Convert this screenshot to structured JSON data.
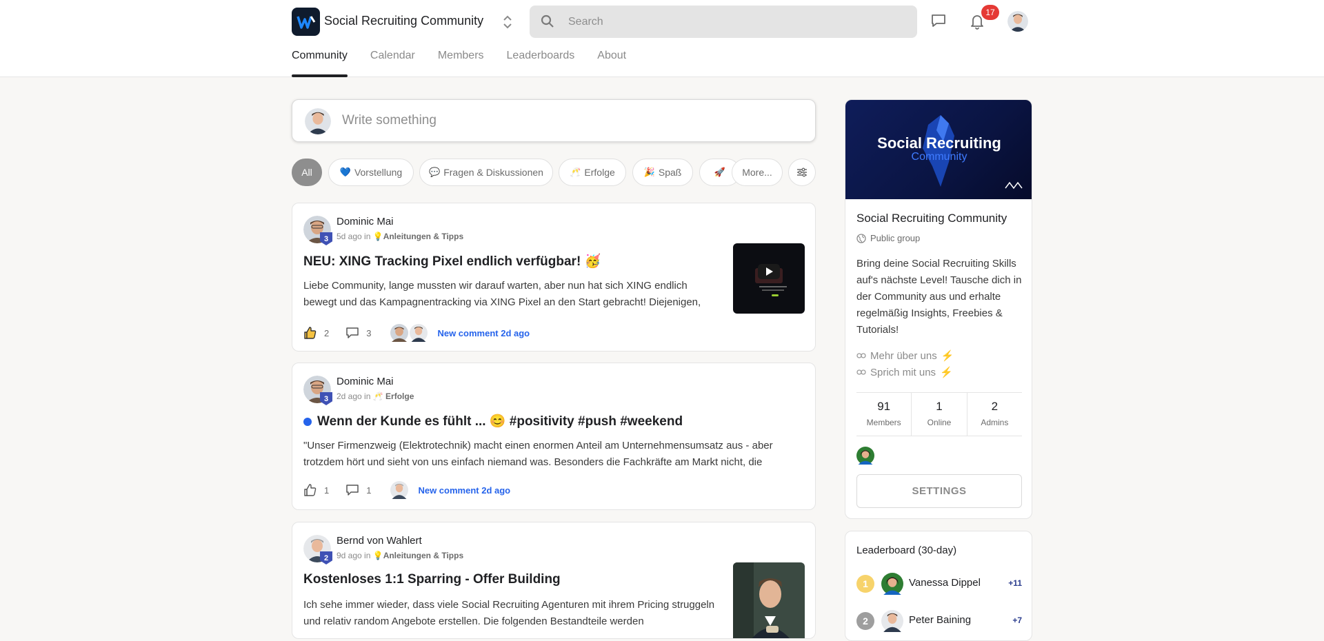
{
  "header": {
    "brand": "Social Recruiting Community",
    "search_placeholder": "Search",
    "notifications_count": "17"
  },
  "nav": {
    "tabs": [
      {
        "label": "Community",
        "active": true
      },
      {
        "label": "Calendar",
        "active": false
      },
      {
        "label": "Members",
        "active": false
      },
      {
        "label": "Leaderboards",
        "active": false
      },
      {
        "label": "About",
        "active": false
      }
    ]
  },
  "composer": {
    "placeholder": "Write something"
  },
  "filters": {
    "all": "All",
    "chips": [
      {
        "emoji": "💙",
        "label": "Vorstellung"
      },
      {
        "emoji": "💬",
        "label": "Fragen & Diskussionen"
      },
      {
        "emoji": "🥂",
        "label": "Erfolge"
      },
      {
        "emoji": "🎉",
        "label": "Spaß"
      },
      {
        "emoji": "🚀",
        "label": ""
      }
    ],
    "more": "More..."
  },
  "posts": [
    {
      "author": "Dominic Mai",
      "level": "3",
      "time": "5d ago in",
      "category_emoji": "💡",
      "category": "Anleitungen & Tipps",
      "title": "NEU: XING Tracking Pixel endlich verfügbar! 🥳",
      "body": "Liebe Community, lange mussten wir darauf warten, aber nun hat sich XING endlich bewegt und das Kampagnentracking via XING Pixel an den Start gebracht! Diejenigen,",
      "likes": "2",
      "comments": "3",
      "new_comment": "New comment 2d ago",
      "unread": false
    },
    {
      "author": "Dominic Mai",
      "level": "3",
      "time": "2d ago in",
      "category_emoji": "🥂",
      "category": "Erfolge",
      "title": "Wenn der Kunde es fühlt ... 😊 #positivity #push #weekend",
      "body": "\"Unser Firmenzweig (Elektrotechnik) macht einen enormen Anteil am Unternehmensumsatz aus - aber trotzdem hört und sieht von uns einfach niemand was. Besonders die Fachkräfte am Markt nicht, die",
      "likes": "1",
      "comments": "1",
      "new_comment": "New comment 2d ago",
      "unread": true
    },
    {
      "author": "Bernd von Wahlert",
      "level": "2",
      "time": "9d ago in",
      "category_emoji": "💡",
      "category": "Anleitungen & Tipps",
      "title": "Kostenloses 1:1 Sparring - Offer Building",
      "body": "Ich sehe immer wieder, dass viele Social Recruiting Agenturen mit ihrem Pricing struggeln und relativ random Angebote erstellen. Die folgenden Bestandteile werden",
      "unread": false
    }
  ],
  "group": {
    "banner_line1": "Social Recruiting",
    "banner_line2": "Community",
    "name": "Social Recruiting Community",
    "type": "Public group",
    "description": "Bring deine Social Recruiting Skills auf's nächste Level! Tausche dich in der Community aus und erhalte regelmäßig Insights, Freebies & Tutorials!",
    "links": [
      {
        "label": "Mehr über uns",
        "emoji": "⚡"
      },
      {
        "label": "Sprich mit uns",
        "emoji": "⚡"
      }
    ],
    "stats": [
      {
        "value": "91",
        "label": "Members"
      },
      {
        "value": "1",
        "label": "Online"
      },
      {
        "value": "2",
        "label": "Admins"
      }
    ],
    "settings_label": "SETTINGS"
  },
  "leaderboard": {
    "title": "Leaderboard (30-day)",
    "rows": [
      {
        "rank": "1",
        "name": "Vanessa Dippel",
        "points": "+11"
      },
      {
        "rank": "2",
        "name": "Peter Baining",
        "points": "+7"
      }
    ]
  },
  "colors": {
    "accent_blue": "#2563eb",
    "badge_red": "#e53935",
    "level_badge": "#3f51b5"
  }
}
